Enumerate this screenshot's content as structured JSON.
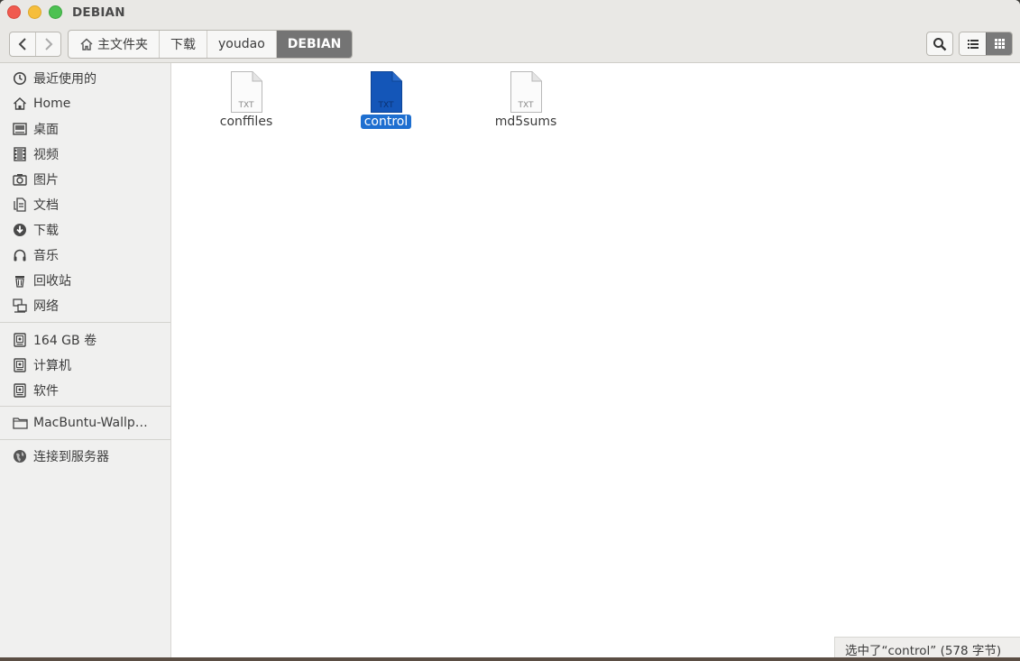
{
  "window": {
    "title": "DEBIAN"
  },
  "toolbar": {
    "back_icon": "back-arrow-icon",
    "forward_icon": "forward-arrow-icon",
    "breadcrumbs": [
      {
        "label": "主文件夹",
        "icon": "home-icon"
      },
      {
        "label": "下载"
      },
      {
        "label": "youdao"
      },
      {
        "label": "DEBIAN",
        "active": true
      }
    ],
    "search_icon": "search-icon",
    "view_list_icon": "list-view-icon",
    "view_grid_icon": "grid-view-icon"
  },
  "sidebar": {
    "places": [
      {
        "label": "最近使用的",
        "icon": "clock-icon"
      },
      {
        "label": "Home",
        "icon": "home-icon"
      },
      {
        "label": "桌面",
        "icon": "desktop-icon"
      },
      {
        "label": "视频",
        "icon": "film-icon"
      },
      {
        "label": "图片",
        "icon": "camera-icon"
      },
      {
        "label": "文档",
        "icon": "document-icon"
      },
      {
        "label": "下载",
        "icon": "download-icon"
      },
      {
        "label": "音乐",
        "icon": "headphones-icon"
      },
      {
        "label": "回收站",
        "icon": "trash-icon"
      },
      {
        "label": "网络",
        "icon": "network-icon"
      }
    ],
    "devices": [
      {
        "label": "164 GB 卷",
        "icon": "drive-icon"
      },
      {
        "label": "计算机",
        "icon": "drive-icon"
      },
      {
        "label": "软件",
        "icon": "drive-icon"
      }
    ],
    "bookmarks": [
      {
        "label": "MacBuntu-Wallp…",
        "icon": "folder-icon"
      }
    ],
    "network": [
      {
        "label": "连接到服务器",
        "icon": "globe-icon"
      }
    ]
  },
  "files": [
    {
      "name": "conffiles",
      "type_label": "TXT",
      "selected": false
    },
    {
      "name": "control",
      "type_label": "TXT",
      "selected": true
    },
    {
      "name": "md5sums",
      "type_label": "TXT",
      "selected": false
    }
  ],
  "status": {
    "text": "选中了“control” (578 字节)"
  },
  "colors": {
    "selection": "#1e6fd0",
    "active_crumb": "#747474",
    "sidebar_bg": "#f0f0ef"
  }
}
